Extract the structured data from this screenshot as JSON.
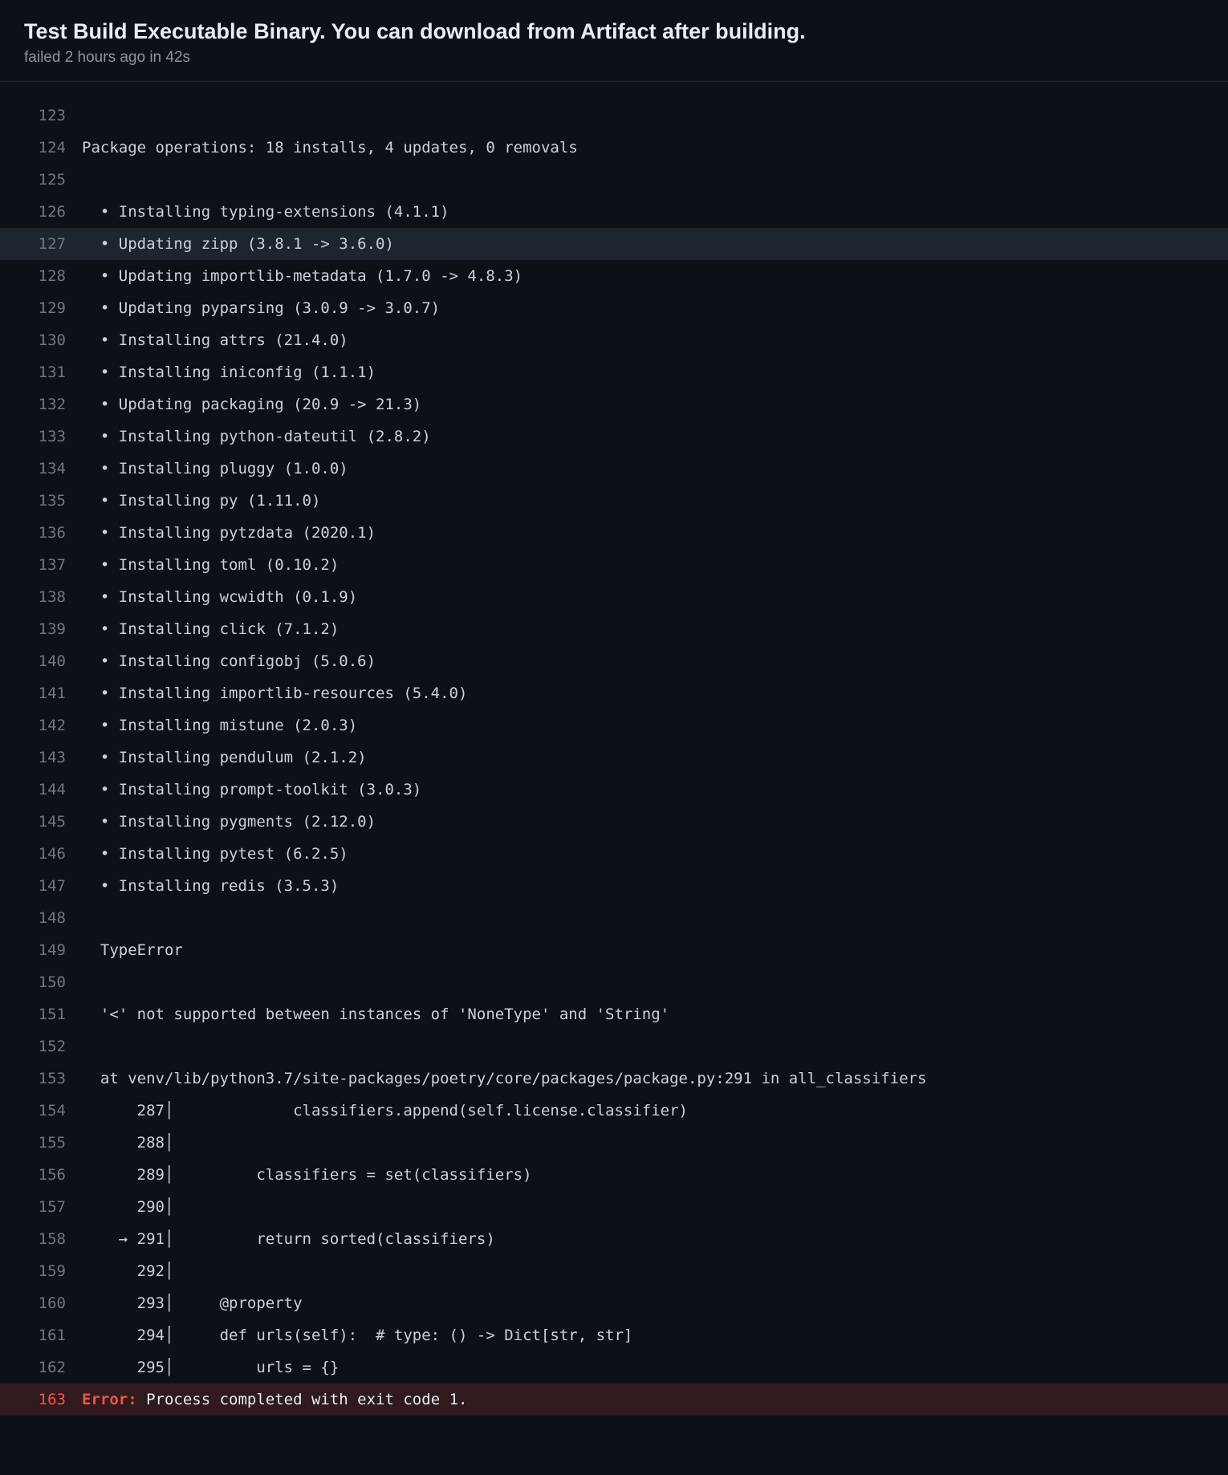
{
  "header": {
    "title": "Test Build Executable Binary. You can download from Artifact after building.",
    "status": "failed 2 hours ago in 42s"
  },
  "log": [
    {
      "n": 123,
      "text": ""
    },
    {
      "n": 124,
      "text": "Package operations: 18 installs, 4 updates, 0 removals"
    },
    {
      "n": 125,
      "text": ""
    },
    {
      "n": 126,
      "text": "  • Installing typing-extensions (4.1.1)"
    },
    {
      "n": 127,
      "text": "  • Updating zipp (3.8.1 -> 3.6.0)",
      "hl": true
    },
    {
      "n": 128,
      "text": "  • Updating importlib-metadata (1.7.0 -> 4.8.3)"
    },
    {
      "n": 129,
      "text": "  • Updating pyparsing (3.0.9 -> 3.0.7)"
    },
    {
      "n": 130,
      "text": "  • Installing attrs (21.4.0)"
    },
    {
      "n": 131,
      "text": "  • Installing iniconfig (1.1.1)"
    },
    {
      "n": 132,
      "text": "  • Updating packaging (20.9 -> 21.3)"
    },
    {
      "n": 133,
      "text": "  • Installing python-dateutil (2.8.2)"
    },
    {
      "n": 134,
      "text": "  • Installing pluggy (1.0.0)"
    },
    {
      "n": 135,
      "text": "  • Installing py (1.11.0)"
    },
    {
      "n": 136,
      "text": "  • Installing pytzdata (2020.1)"
    },
    {
      "n": 137,
      "text": "  • Installing toml (0.10.2)"
    },
    {
      "n": 138,
      "text": "  • Installing wcwidth (0.1.9)"
    },
    {
      "n": 139,
      "text": "  • Installing click (7.1.2)"
    },
    {
      "n": 140,
      "text": "  • Installing configobj (5.0.6)"
    },
    {
      "n": 141,
      "text": "  • Installing importlib-resources (5.4.0)"
    },
    {
      "n": 142,
      "text": "  • Installing mistune (2.0.3)"
    },
    {
      "n": 143,
      "text": "  • Installing pendulum (2.1.2)"
    },
    {
      "n": 144,
      "text": "  • Installing prompt-toolkit (3.0.3)"
    },
    {
      "n": 145,
      "text": "  • Installing pygments (2.12.0)"
    },
    {
      "n": 146,
      "text": "  • Installing pytest (6.2.5)"
    },
    {
      "n": 147,
      "text": "  • Installing redis (3.5.3)"
    },
    {
      "n": 148,
      "text": ""
    },
    {
      "n": 149,
      "text": "  TypeError"
    },
    {
      "n": 150,
      "text": ""
    },
    {
      "n": 151,
      "text": "  '<' not supported between instances of 'NoneType' and 'String'"
    },
    {
      "n": 152,
      "text": ""
    },
    {
      "n": 153,
      "text": "  at venv/lib/python3.7/site-packages/poetry/core/packages/package.py:291 in all_classifiers"
    },
    {
      "n": 154,
      "text": "      287│             classifiers.append(self.license.classifier)"
    },
    {
      "n": 155,
      "text": "      288│ "
    },
    {
      "n": 156,
      "text": "      289│         classifiers = set(classifiers)"
    },
    {
      "n": 157,
      "text": "      290│ "
    },
    {
      "n": 158,
      "text": "    → 291│         return sorted(classifiers)"
    },
    {
      "n": 159,
      "text": "      292│ "
    },
    {
      "n": 160,
      "text": "      293│     @property"
    },
    {
      "n": 161,
      "text": "      294│     def urls(self):  # type: () -> Dict[str, str]"
    },
    {
      "n": 162,
      "text": "      295│         urls = {}"
    },
    {
      "n": 163,
      "prefix": "Error:",
      "text": " Process completed with exit code 1.",
      "error": true
    }
  ]
}
